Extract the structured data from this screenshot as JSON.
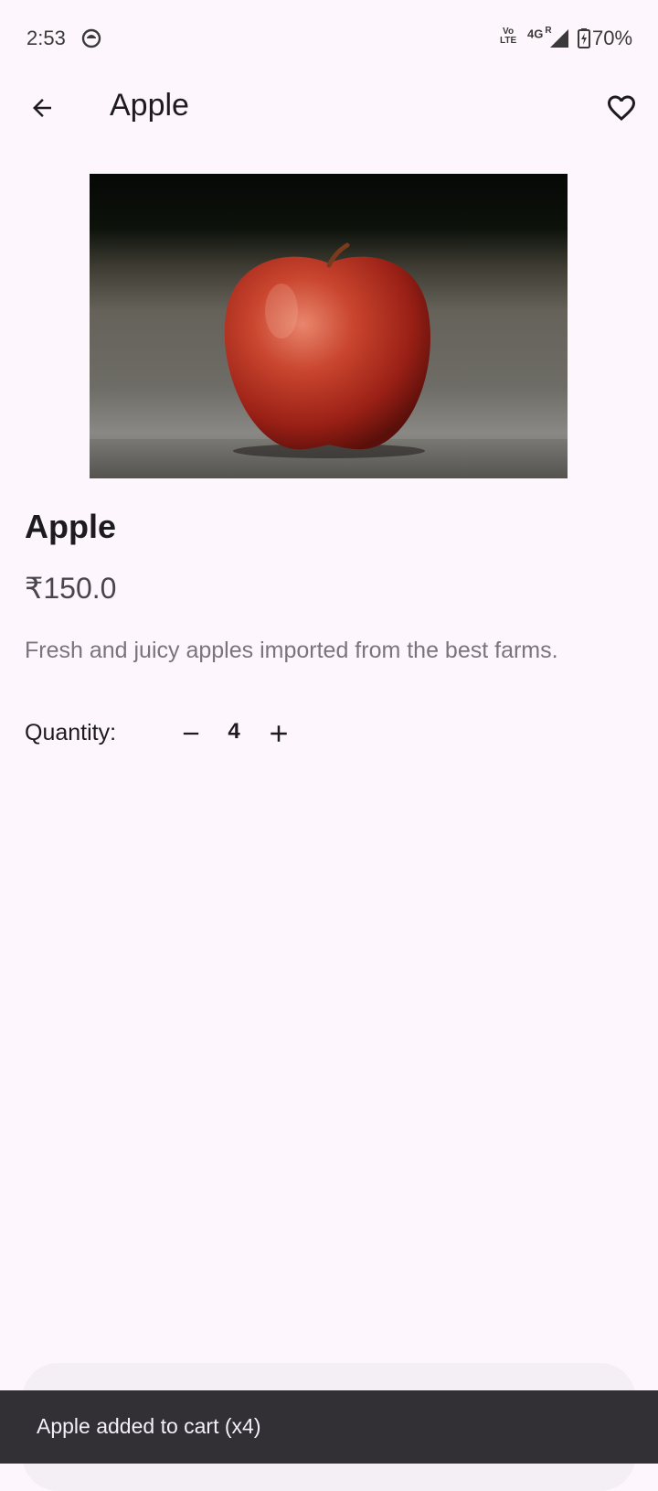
{
  "status_bar": {
    "time": "2:53",
    "volte_top": "Vo",
    "volte_bottom": "LTE",
    "network": "4G",
    "roaming": "R",
    "battery": "70%"
  },
  "app_bar": {
    "title": "Apple",
    "back_icon": "arrow-back-icon",
    "favorite_icon": "heart-outline-icon"
  },
  "product": {
    "image_alt": "red apple photo",
    "name": "Apple",
    "price": "₹150.0",
    "description": "Fresh and juicy apples imported from the best farms."
  },
  "quantity": {
    "label": "Quantity:",
    "value": "4",
    "minus_icon": "minus-icon",
    "plus_icon": "plus-icon"
  },
  "snackbar": {
    "message": "Apple added to cart (x4)"
  },
  "colors": {
    "background": "#fdf6fc",
    "text": "#1d1b20",
    "muted_text": "#79747e",
    "snackbar_bg": "#322f35"
  }
}
